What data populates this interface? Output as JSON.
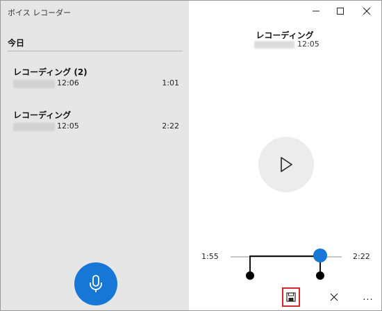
{
  "app": {
    "title": "ボイス レコーダー"
  },
  "list": {
    "section": "今日",
    "recordings": [
      {
        "name": "レコーディング (2)",
        "time": "12:06",
        "duration": "1:01"
      },
      {
        "name": "レコーディング",
        "time": "12:05",
        "duration": "2:22"
      }
    ]
  },
  "detail": {
    "title": "レコーディング",
    "time": "12:05"
  },
  "trim": {
    "start_label": "1:55",
    "end_label": "2:22"
  },
  "toolbar": {
    "more_label": "..."
  },
  "colors": {
    "accent": "#1677d6",
    "highlight": "#d9262d",
    "sidebar_bg": "#e6e6e6"
  },
  "icons": {
    "record": "microphone-icon",
    "play": "play-icon",
    "save": "save-icon",
    "discard": "close-icon",
    "window": [
      "minimize-icon",
      "maximize-icon",
      "close-icon"
    ]
  }
}
